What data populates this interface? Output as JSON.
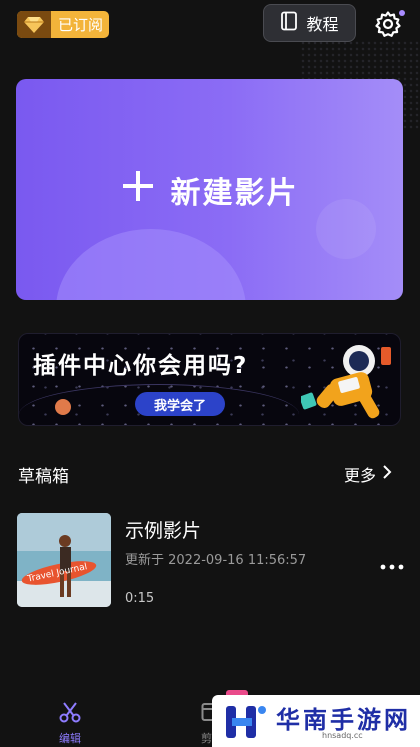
{
  "header": {
    "vip_label": "已订阅",
    "tutorial_label": "教程"
  },
  "new_project": {
    "label": "新建影片"
  },
  "plugin_banner": {
    "title": "插件中心你会用吗?",
    "button_label": "我学会了"
  },
  "drafts": {
    "title": "草稿箱",
    "more_label": "更多",
    "items": [
      {
        "name": "示例影片",
        "updated": "更新于 2022-09-16 11:56:57",
        "duration": "0:15",
        "thumbnail_text": "Travel Journal"
      }
    ]
  },
  "bottom_nav": {
    "items": [
      {
        "label": "编辑",
        "active": true
      },
      {
        "label": "剪同"
      }
    ]
  },
  "watermark": {
    "title": "华南手游网",
    "domain": "hnsadq.cc"
  },
  "colors": {
    "accent": "#8e7cff",
    "card_gradient_start": "#7a59f0",
    "card_gradient_end": "#a48df8",
    "vip": "#f3b43a",
    "background": "#121212"
  }
}
